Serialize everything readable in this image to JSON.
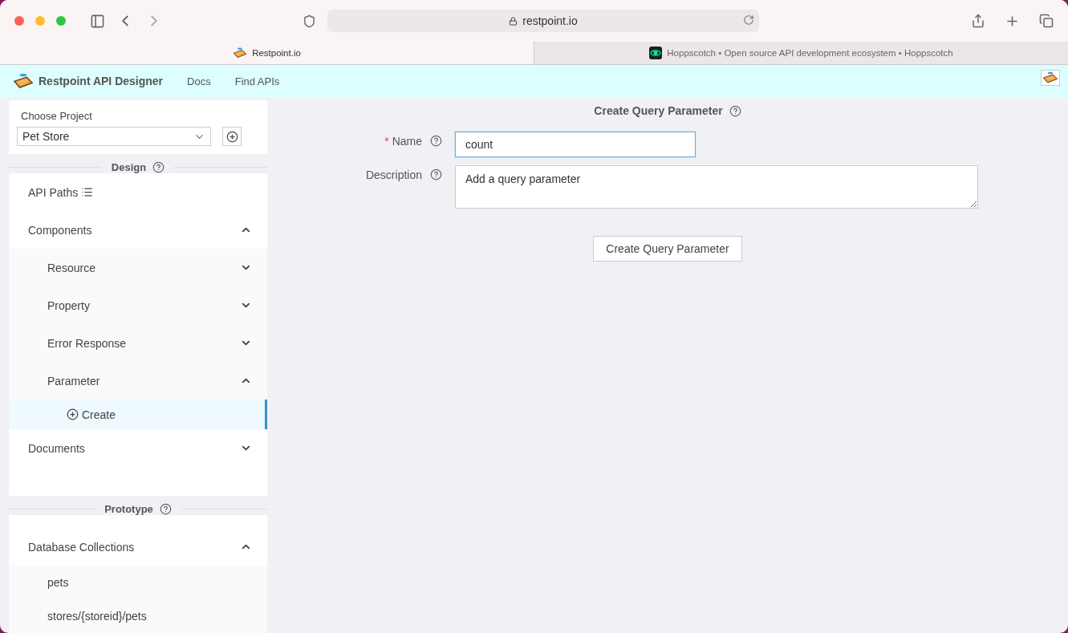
{
  "browser": {
    "address": "restpoint.io",
    "tabs": [
      {
        "title": "Restpoint.io",
        "selected": true,
        "kind": "restpoint"
      },
      {
        "title": "Hoppscotch • Open source API development ecosystem • Hoppscotch",
        "selected": false,
        "kind": "hoppscotch"
      }
    ]
  },
  "header": {
    "title": "Restpoint API Designer",
    "links": [
      "Docs",
      "Find APIs"
    ]
  },
  "sidebar": {
    "project_label": "Choose Project",
    "project": "Pet Store",
    "sections": [
      {
        "title": "Design",
        "items": [
          {
            "label": "API Paths",
            "kind": "paths",
            "selected": false
          },
          {
            "label": "Components",
            "kind": "group",
            "expanded": true,
            "selected": false,
            "children": [
              {
                "label": "Resource",
                "kind": "group",
                "expanded": false,
                "selected": false
              },
              {
                "label": "Property",
                "kind": "group",
                "expanded": false,
                "selected": false
              },
              {
                "label": "Error Response",
                "kind": "group",
                "expanded": false,
                "selected": false
              },
              {
                "label": "Parameter",
                "kind": "group",
                "expanded": true,
                "selected": false,
                "children": [
                  {
                    "label": "Create",
                    "kind": "create",
                    "selected": true
                  }
                ]
              }
            ]
          },
          {
            "label": "Documents",
            "kind": "group",
            "expanded": false,
            "selected": false
          }
        ]
      },
      {
        "title": "Prototype",
        "items": [
          {
            "label": "Database Collections",
            "kind": "group",
            "expanded": true,
            "selected": false,
            "children": [
              {
                "label": "pets",
                "kind": "leaf",
                "selected": false
              },
              {
                "label": "stores/{storeid}/pets",
                "kind": "leaf",
                "selected": false
              }
            ]
          }
        ]
      }
    ]
  },
  "form": {
    "title": "Create Query Parameter",
    "fields": [
      {
        "label": "Name",
        "required_mark": "*",
        "kind": "input",
        "value": "count"
      },
      {
        "label": "Description",
        "kind": "textarea",
        "value": "Add a query parameter"
      }
    ],
    "submit": "Create Query Parameter"
  }
}
